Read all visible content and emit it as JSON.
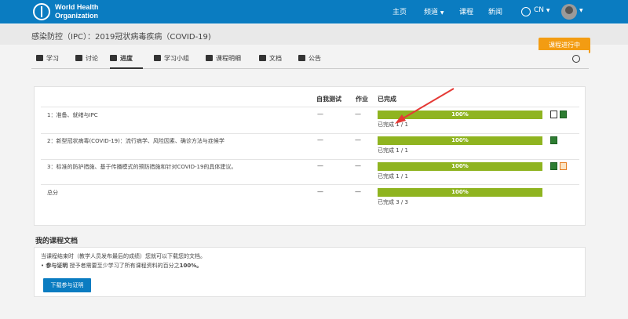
{
  "header": {
    "brand_line1": "World Health",
    "brand_line2": "Organization",
    "nav": [
      "主页",
      "频道",
      "课程",
      "新闻"
    ],
    "language": "CN"
  },
  "course": {
    "title": "感染防控（IPC）：2019冠状病毒疾病（COVID-19)",
    "status_badge": "课程进行中"
  },
  "tabs": [
    "学习",
    "讨论",
    "进度",
    "学习小组",
    "课程明细",
    "文档",
    "公告"
  ],
  "progress": {
    "headers": {
      "self_test": "自我测试",
      "homework": "作业",
      "completed": "已完成"
    },
    "rows": [
      {
        "label": "1：准备、就绪与IPC",
        "self_test": "—",
        "homework": "—",
        "percent": "100%",
        "status": "已完成 1 / 1"
      },
      {
        "label": "2：新型冠状病毒(COVID-19)：流行病学、风险因素、确诊方法与症候学",
        "self_test": "—",
        "homework": "—",
        "percent": "100%",
        "status": "已完成 1 / 1"
      },
      {
        "label": "3：标准的防护措施、基于传播模式的预防措施和针对COVID-19的具体建议。",
        "self_test": "—",
        "homework": "—",
        "percent": "100%",
        "status": "已完成 1 / 1"
      },
      {
        "label": "总分",
        "self_test": "—",
        "homework": "—",
        "percent": "100%",
        "status": "已完成 3 / 3"
      }
    ]
  },
  "documents": {
    "title": "我的课程文档",
    "note": "当课程结束时（教学人员发布最后的成绩）您就可以下载您的文档。",
    "bullet_strong": "参与证明",
    "bullet_text": " 授予者需要至少学习了所有课程资料的百分之",
    "bullet_percent": "100%。",
    "download_button": "下载参与证明"
  },
  "colors": {
    "top_bar": "#0a7cc1",
    "progress": "#8fb420",
    "badge": "#f39c12"
  }
}
